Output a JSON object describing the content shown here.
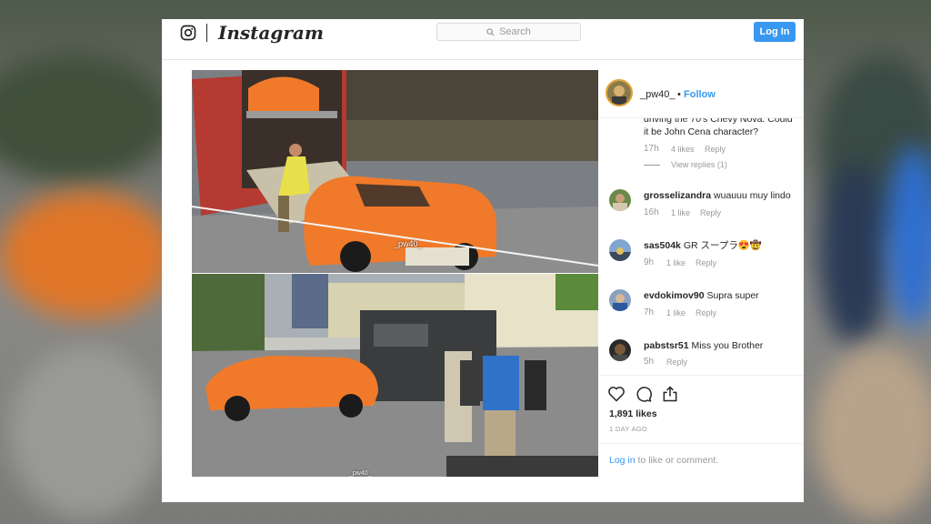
{
  "header": {
    "brand": "Instagram",
    "search_placeholder": "Search",
    "login_label": "Log In"
  },
  "post": {
    "username": "_pw40_",
    "separator": "•",
    "follow_label": "Follow",
    "photo_watermark": "_pw40_",
    "photo_watermark_small": "_pw40_"
  },
  "comments": [
    {
      "user": "",
      "text": "driving the 70's Chevy Nova. Could it be John Cena character?",
      "time": "17h",
      "likes": "4 likes",
      "reply": "Reply",
      "view_replies": "View replies (1)"
    },
    {
      "user": "grosselizandra",
      "text": "wuauuu muy lindo",
      "time": "16h",
      "likes": "1 like",
      "reply": "Reply"
    },
    {
      "user": "sas504k",
      "text": "GR スープラ😍🤠",
      "time": "9h",
      "likes": "1 like",
      "reply": "Reply"
    },
    {
      "user": "evdokimov90",
      "text": "Supra super",
      "time": "7h",
      "likes": "1 like",
      "reply": "Reply"
    },
    {
      "user": "pabstsr51",
      "text": "Miss you Brother",
      "time": "5h",
      "likes": "",
      "reply": "Reply"
    }
  ],
  "stats": {
    "likes": "1,891 likes",
    "date": "1 DAY AGO"
  },
  "login_prompt": {
    "link": "Log in",
    "rest": " to like or comment."
  },
  "icons": [
    "instagram-icon",
    "search-icon",
    "heart-icon",
    "comment-icon",
    "share-icon"
  ],
  "colors": {
    "accent": "#3897f0",
    "car": "#f07a2a"
  }
}
